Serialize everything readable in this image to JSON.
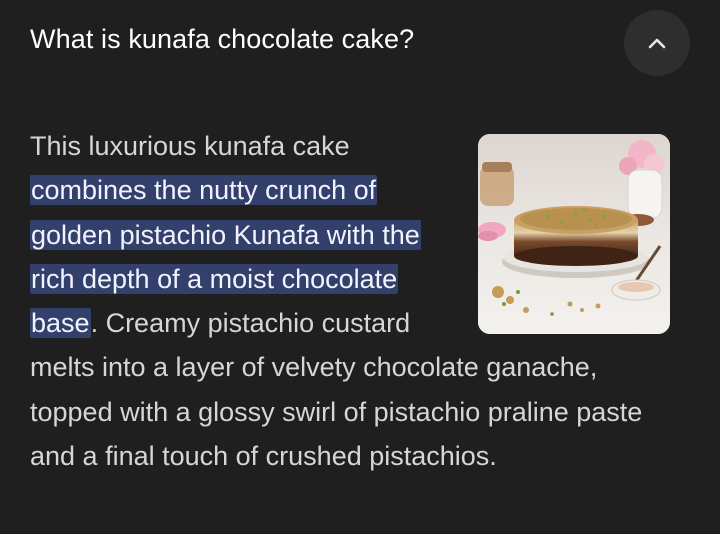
{
  "question": "What is kunafa chocolate cake?",
  "collapse_icon": "chevron-up-icon",
  "answer": {
    "intro": "This luxurious kunafa cake ",
    "highlight": "combines the nutty crunch of golden pistachio Kunafa with the rich depth of a moist chocolate base",
    "rest": ". Creamy pistachio custard melts into a layer of velvety chocolate ganache, topped with a glossy swirl of pistachio praline paste and a final touch of crushed pistachios."
  },
  "thumbnail_icon": "kunafa-cake-photo",
  "colors": {
    "background": "#1f1f1f",
    "highlight": "#33406b",
    "button": "#2e2e2e"
  }
}
